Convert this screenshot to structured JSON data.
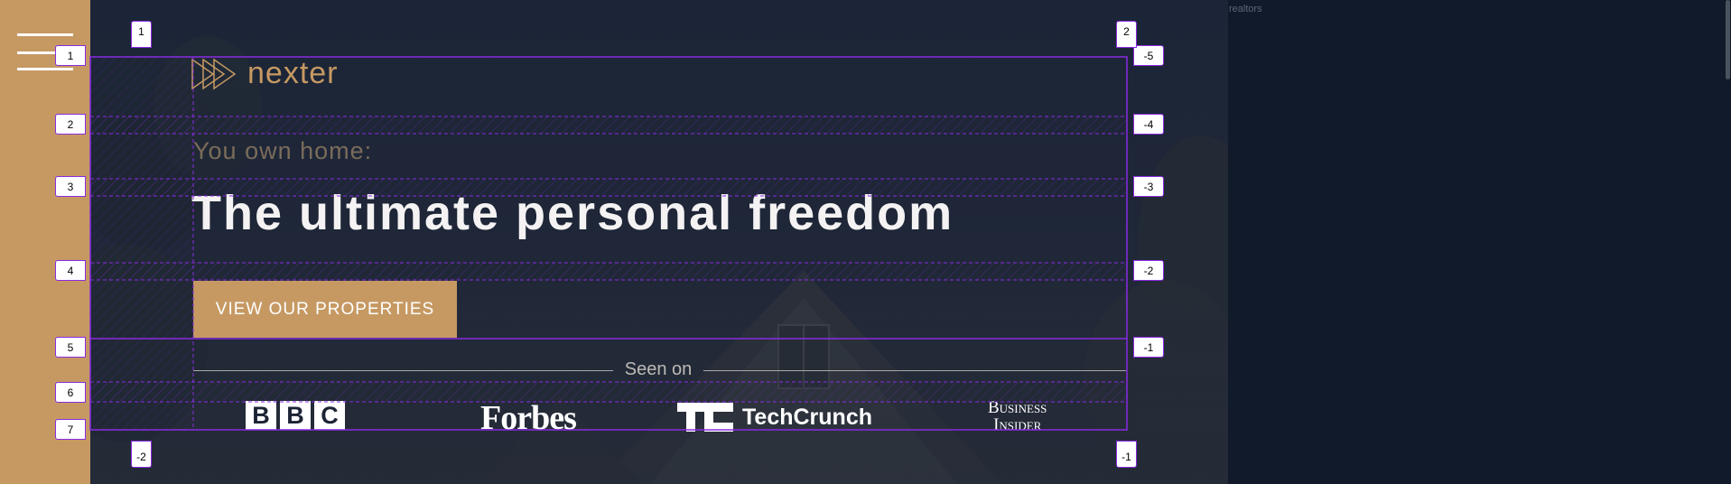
{
  "sidebar": {
    "menu_icon": "hamburger-menu-icon"
  },
  "header": {
    "logo_icon": "triple-triangle-logo-icon",
    "logo_text": "nexter",
    "subtitle": "You own home:",
    "headline": "The ultimate personal freedom",
    "cta_label": "VIEW OUR PROPERTIES",
    "seen_on": "Seen on",
    "press_logos": {
      "bbc": [
        "B",
        "B",
        "C"
      ],
      "forbes": "Forbes",
      "techcrunch": "TechCrunch",
      "business_insider_line1": "Business",
      "business_insider_line2": "Insider"
    }
  },
  "right_panel": {
    "label": "realtors"
  },
  "grid_overlay": {
    "row_start_labels": [
      "1",
      "2",
      "3",
      "4",
      "5",
      "6",
      "7"
    ],
    "row_end_labels": [
      "-5",
      "-4",
      "-3",
      "-2",
      "-1"
    ],
    "col_top_labels": [
      "1",
      "2"
    ],
    "col_bottom_labels": [
      "-2",
      "-1"
    ]
  },
  "colors": {
    "accent": "#c69963",
    "dark_bg": "#101a2a",
    "header_text": "#f4f2f2",
    "grid_line": "#8a2be2"
  }
}
